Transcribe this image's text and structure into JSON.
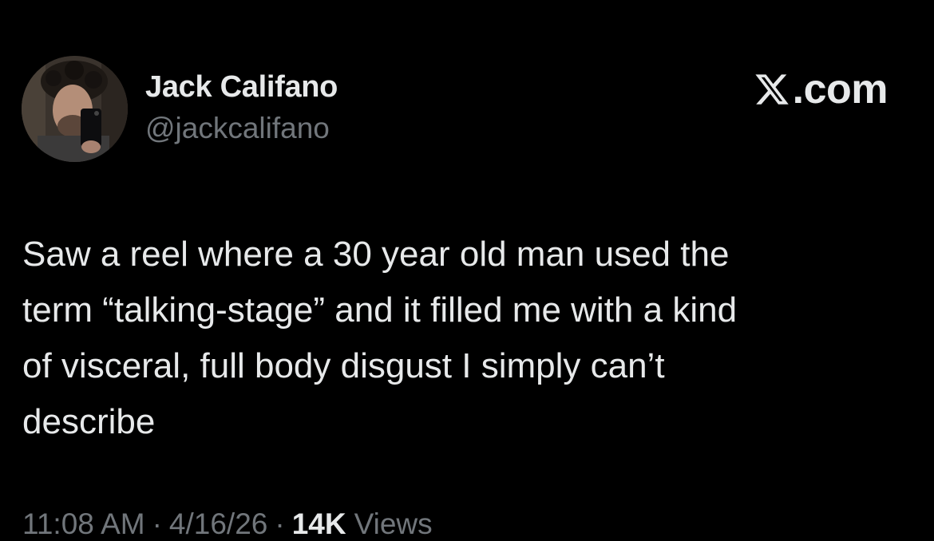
{
  "author": {
    "display_name": "Jack Califano",
    "handle": "@jackcalifano"
  },
  "brand": {
    "text": ".com",
    "icon": "x-logo-icon"
  },
  "tweet": {
    "text": "Saw a reel where a 30 year old man used the\nterm “talking-stage” and it filled me with a kind\nof visceral, full body disgust I simply can’t\ndescribe"
  },
  "meta": {
    "time": "11:08 AM",
    "separator": "·",
    "date": "4/16/26",
    "views_count": "14K",
    "views_label": "Views"
  },
  "colors": {
    "background": "#000000",
    "primary_text": "#e7e9ea",
    "secondary_text": "#71767b"
  }
}
